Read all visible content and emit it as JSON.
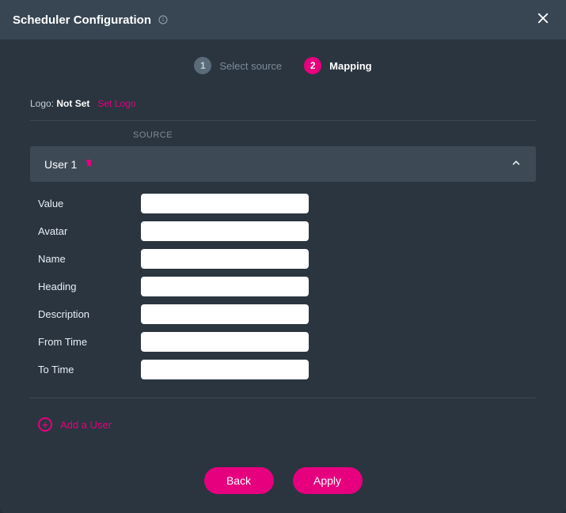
{
  "header": {
    "title": "Scheduler Configuration"
  },
  "steps": [
    {
      "num": "1",
      "label": "Select source"
    },
    {
      "num": "2",
      "label": "Mapping"
    }
  ],
  "logo": {
    "label": "Logo:",
    "value": "Not Set",
    "set_link": "Set Logo"
  },
  "source_header": "SOURCE",
  "accordion": {
    "title": "User 1",
    "fields": [
      {
        "label": "Value",
        "value": ""
      },
      {
        "label": "Avatar",
        "value": ""
      },
      {
        "label": "Name",
        "value": ""
      },
      {
        "label": "Heading",
        "value": ""
      },
      {
        "label": "Description",
        "value": ""
      },
      {
        "label": "From Time",
        "value": ""
      },
      {
        "label": "To Time",
        "value": ""
      }
    ]
  },
  "add_user_label": "Add a User",
  "footer": {
    "back": "Back",
    "apply": "Apply"
  }
}
